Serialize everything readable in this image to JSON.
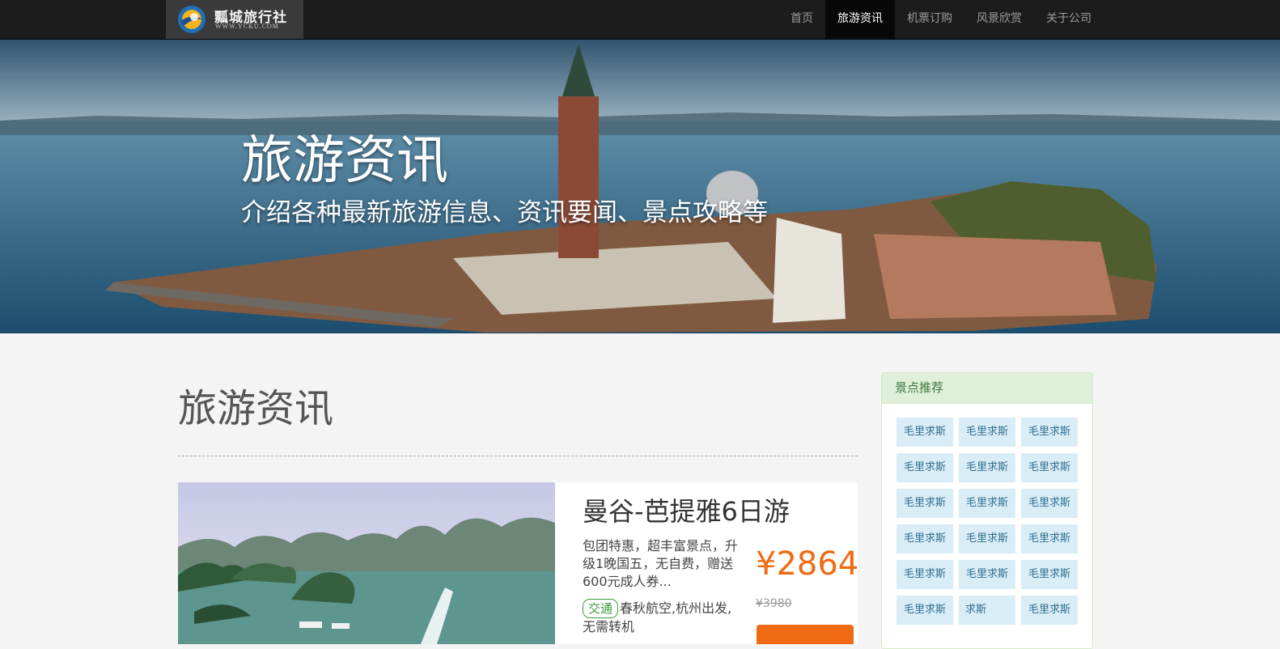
{
  "brand": {
    "title": "瓢城旅行社",
    "url": "WWW.YCKU.COM"
  },
  "nav": {
    "items": [
      {
        "label": "首页",
        "active": false
      },
      {
        "label": "旅游资讯",
        "active": true
      },
      {
        "label": "机票订购",
        "active": false
      },
      {
        "label": "风景欣赏",
        "active": false
      },
      {
        "label": "关于公司",
        "active": false
      }
    ]
  },
  "hero": {
    "title": "旅游资讯",
    "subtitle": "介绍各种最新旅游信息、资讯要闻、景点攻略等"
  },
  "main": {
    "section_title": "旅游资讯",
    "trip": {
      "title": "曼谷-芭提雅6日游",
      "description": "包团特惠，超丰富景点，升级1晚国五，无自费，赠送600元成人券...",
      "tag": "交通",
      "info": "春秋航空,杭州出发,无需转机",
      "price": "¥2864",
      "old_price": "¥3980"
    }
  },
  "sidebar": {
    "heading": "景点推荐",
    "spots": [
      "毛里求斯",
      "毛里求斯",
      "毛里求斯",
      "毛里求斯",
      "毛里求斯",
      "毛里求斯",
      "毛里求斯",
      "毛里求斯",
      "毛里求斯",
      "毛里求斯",
      "毛里求斯",
      "毛里求斯",
      "毛里求斯",
      "毛里求斯",
      "毛里求斯",
      "毛里求斯",
      "求斯",
      "毛里求斯"
    ]
  },
  "colors": {
    "nav_bg": "#1c1c1c",
    "price": "#f06a13",
    "panel_heading_bg": "#dff0d8",
    "spot_bg": "#d9edf7"
  }
}
